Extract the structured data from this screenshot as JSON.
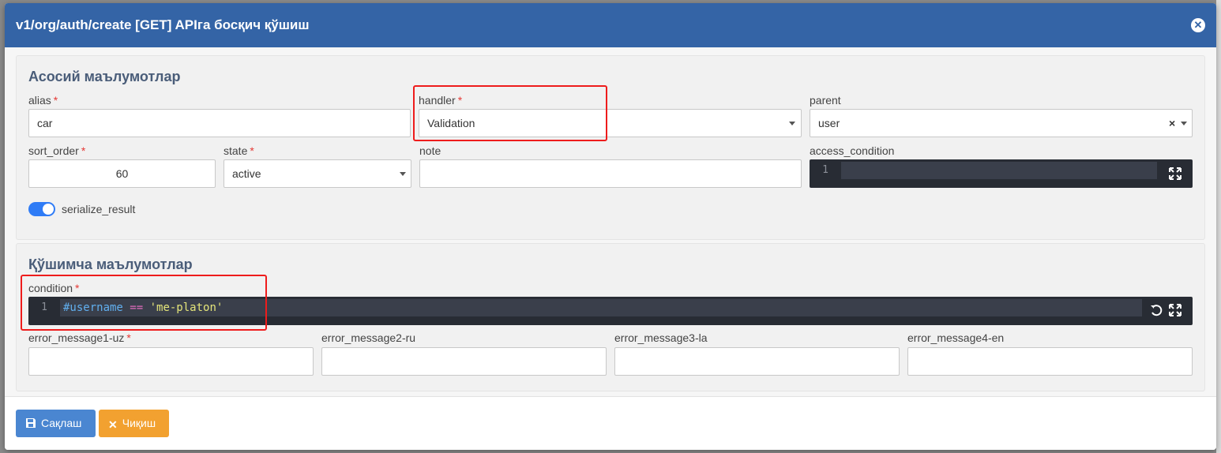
{
  "modal": {
    "title": "v1/org/auth/create [GET] APIга босқич қўшиш",
    "close_icon": "close-circle-icon"
  },
  "main_section": {
    "title": "Асосий маълумотлар",
    "alias": {
      "label": "alias",
      "value": "car"
    },
    "handler": {
      "label": "handler",
      "value": "Validation"
    },
    "parent": {
      "label": "parent",
      "value": "user",
      "clear": "×"
    },
    "sort_order": {
      "label": "sort_order",
      "value": "60"
    },
    "state": {
      "label": "state",
      "value": "active"
    },
    "note": {
      "label": "note",
      "value": ""
    },
    "access_condition": {
      "label": "access_condition",
      "line_number": "1",
      "code": ""
    },
    "serialize_result": {
      "label": "serialize_result",
      "enabled": true
    }
  },
  "extra_section": {
    "title": "Қўшимча маълумотлар",
    "condition": {
      "label": "condition",
      "line_number": "1",
      "code_var": "#username",
      "code_op": "==",
      "code_str": "'me-platon'"
    },
    "error_message1": {
      "label": "error_message1-uz",
      "value": ""
    },
    "error_message2": {
      "label": "error_message2-ru",
      "value": ""
    },
    "error_message3": {
      "label": "error_message3-la",
      "value": ""
    },
    "error_message4": {
      "label": "error_message4-en",
      "value": ""
    }
  },
  "required_mark": "*",
  "footer": {
    "save_label": "Сақлаш",
    "exit_label": "Чиқиш"
  },
  "colors": {
    "header": "#3464a6",
    "save_button": "#4a86d1",
    "exit_button": "#f2a130",
    "highlight": "#ee1c1c",
    "toggle": "#2f7cf6"
  }
}
